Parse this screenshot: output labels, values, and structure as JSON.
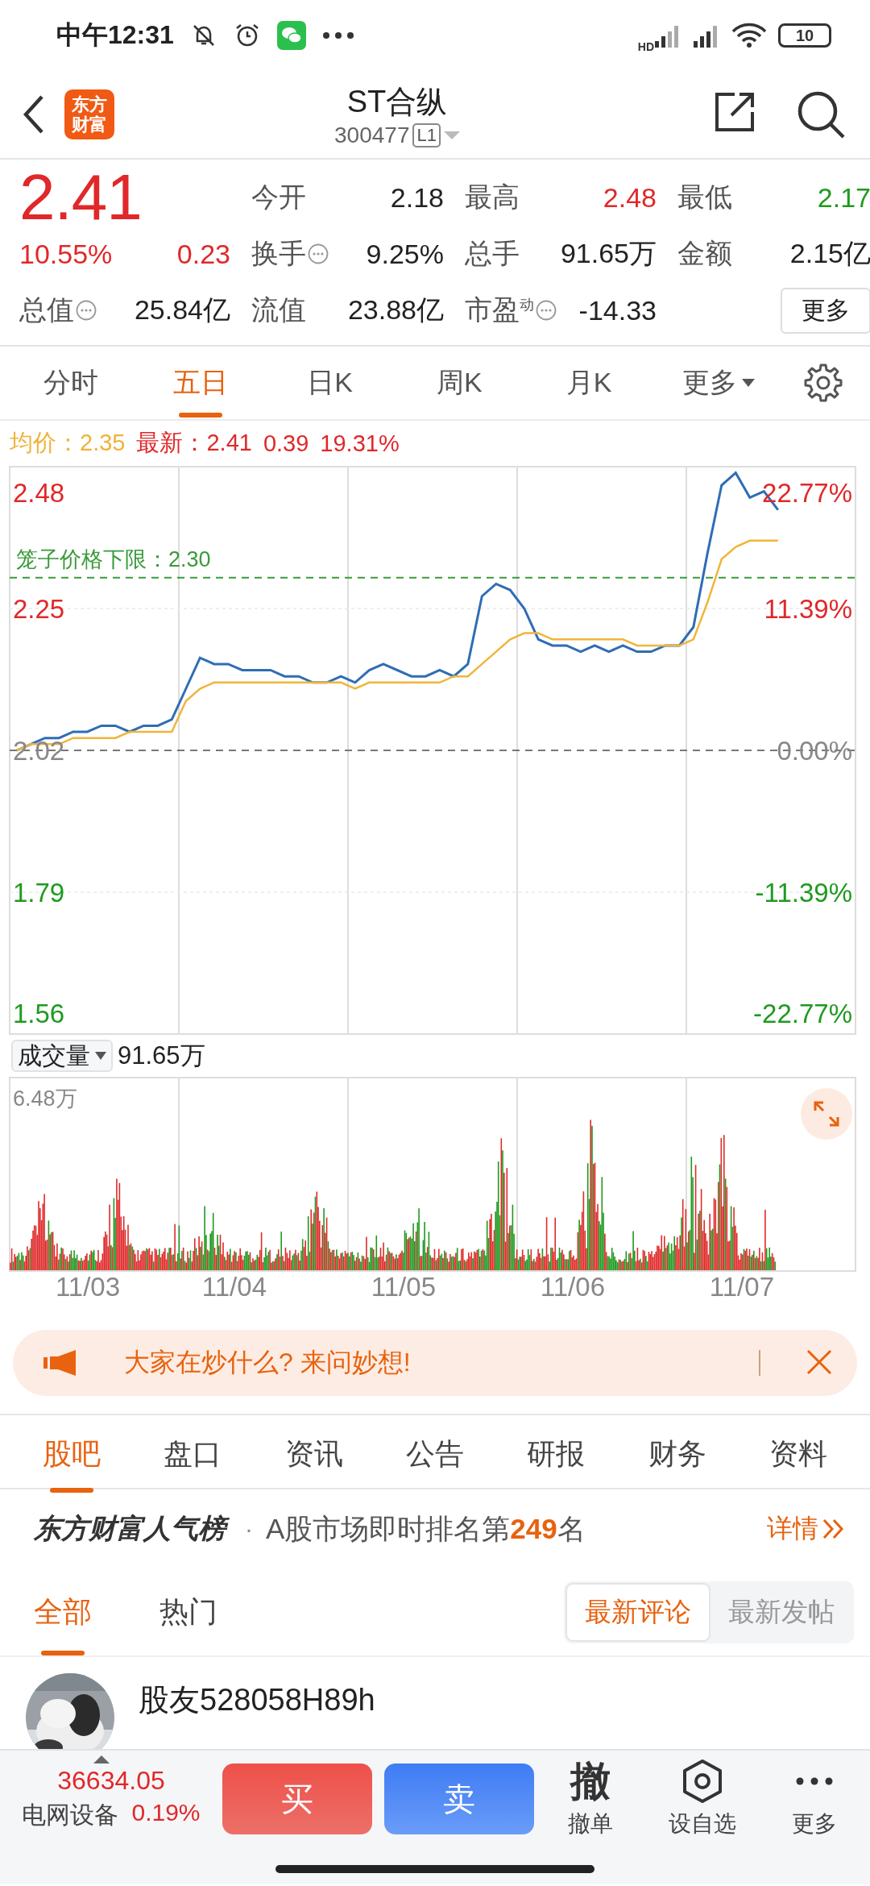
{
  "status_bar": {
    "time": "中午12:31",
    "network_label": "HD",
    "battery": "10"
  },
  "header": {
    "logo": [
      "东方",
      "财富"
    ],
    "title": "ST合纵",
    "code": "300477",
    "level_badge": "L1"
  },
  "quote": {
    "price": "2.41",
    "change_pct": "10.55%",
    "change": "0.23",
    "stats": [
      {
        "label": "今开",
        "value": "2.18",
        "color": "#222222",
        "info": false
      },
      {
        "label": "最高",
        "value": "2.48",
        "color": "#e0282a",
        "info": false
      },
      {
        "label": "最低",
        "value": "2.17",
        "color": "#1f9a1f",
        "info": false
      },
      {
        "label": "换手",
        "value": "9.25%",
        "color": "#222222",
        "info": true
      },
      {
        "label": "总手",
        "value": "91.65万",
        "color": "#222222",
        "info": false
      },
      {
        "label": "金额",
        "value": "2.15亿",
        "color": "#222222",
        "info": false
      },
      {
        "label": "总值",
        "value": "25.84亿",
        "color": "#222222",
        "info": true
      },
      {
        "label": "流值",
        "value": "23.88亿",
        "color": "#222222",
        "info": false
      },
      {
        "label": "市盈$^{动}$",
        "value": "-14.33",
        "color": "#222222",
        "info": true
      }
    ],
    "more_button": "更多"
  },
  "chart_tabs": [
    {
      "label": "分时",
      "selected": false,
      "kind": "tab"
    },
    {
      "label": "五日",
      "selected": true,
      "kind": "tab"
    },
    {
      "label": "日K",
      "selected": false,
      "kind": "tab"
    },
    {
      "label": "周K",
      "selected": false,
      "kind": "tab"
    },
    {
      "label": "月K",
      "selected": false,
      "kind": "tab"
    },
    {
      "label": "更多",
      "selected": false,
      "kind": "menu"
    }
  ],
  "chart_info": {
    "avg": "均价：2.35",
    "last": "最新：2.41",
    "change": "0.39",
    "change_pct": "19.31%"
  },
  "price_chart": {
    "percent_labels": [
      "22.77%",
      "11.39%",
      "0.00%",
      "-11.39%",
      "-22.77%"
    ],
    "chart_data": {
      "type": "line",
      "ylim": [
        1.56,
        2.48
      ],
      "yticks": [
        2.48,
        2.25,
        2.02,
        1.79,
        1.56
      ],
      "series": [
        {
          "color": "#2f6db5",
          "values": [
            2.02,
            2.03,
            2.04,
            2.04,
            2.05,
            2.05,
            2.06,
            2.06,
            2.05,
            2.06,
            2.06,
            2.07,
            2.12,
            2.17,
            2.16,
            2.16,
            2.15,
            2.15,
            2.15,
            2.14,
            2.14,
            2.13,
            2.13,
            2.14,
            2.13,
            2.15,
            2.16,
            2.15,
            2.14,
            2.14,
            2.15,
            2.14,
            2.16,
            2.27,
            2.29,
            2.28,
            2.25,
            2.2,
            2.19,
            2.19,
            2.18,
            2.19,
            2.18,
            2.19,
            2.18,
            2.18,
            2.19,
            2.19,
            2.22,
            2.34,
            2.45,
            2.47,
            2.43,
            2.44,
            2.41
          ]
        },
        {
          "color": "#f0b53c",
          "values": [
            2.02,
            2.03,
            2.03,
            2.03,
            2.04,
            2.04,
            2.04,
            2.04,
            2.05,
            2.05,
            2.05,
            2.05,
            2.1,
            2.12,
            2.13,
            2.13,
            2.13,
            2.13,
            2.13,
            2.13,
            2.13,
            2.13,
            2.13,
            2.13,
            2.12,
            2.13,
            2.13,
            2.13,
            2.13,
            2.13,
            2.13,
            2.14,
            2.14,
            2.16,
            2.18,
            2.2,
            2.21,
            2.21,
            2.2,
            2.2,
            2.2,
            2.2,
            2.2,
            2.2,
            2.19,
            2.19,
            2.19,
            2.19,
            2.2,
            2.26,
            2.33,
            2.35,
            2.36,
            2.36,
            2.36
          ]
        }
      ],
      "ref_lines": [
        {
          "axis": "y",
          "value": 2.02
        },
        {
          "axis": "y",
          "value": 2.3,
          "label": "笼子价格下限：2.30"
        }
      ]
    }
  },
  "volume": {
    "selector": "成交量",
    "total": "91.65万",
    "max_label": "6.48万",
    "dates": [
      "11/03",
      "11/04",
      "11/05",
      "11/06",
      "11/07"
    ]
  },
  "banner": {
    "text": "大家在炒什么? 来问妙想!"
  },
  "section_tabs": [
    {
      "label": "股吧",
      "selected": true
    },
    {
      "label": "盘口",
      "selected": false
    },
    {
      "label": "资讯",
      "selected": false
    },
    {
      "label": "公告",
      "selected": false
    },
    {
      "label": "研报",
      "selected": false
    },
    {
      "label": "财务",
      "selected": false
    },
    {
      "label": "资料",
      "selected": false
    }
  ],
  "ranking": {
    "brand": "东方财富人气榜",
    "separator": "·",
    "text": "A股市场即时排名第**249**名",
    "link": "详情"
  },
  "feed_tabs": [
    {
      "label": "全部",
      "selected": true
    },
    {
      "label": "热门",
      "selected": false
    }
  ],
  "sort_options": [
    {
      "label": "最新评论",
      "selected": true
    },
    {
      "label": "最新发帖",
      "selected": false
    }
  ],
  "posts": [
    {
      "user": "股友528058H89h"
    }
  ],
  "bottom_bar": {
    "index_value": "36634.05",
    "index_name": "电网设备",
    "index_change": "0.19%",
    "buy": "买",
    "sell": "卖",
    "actions": [
      {
        "kind": "glyph",
        "glyph": "撤",
        "label": "撤单"
      },
      {
        "kind": "hexagon",
        "label": "设自选"
      },
      {
        "kind": "dots",
        "label": "更多"
      }
    ]
  }
}
